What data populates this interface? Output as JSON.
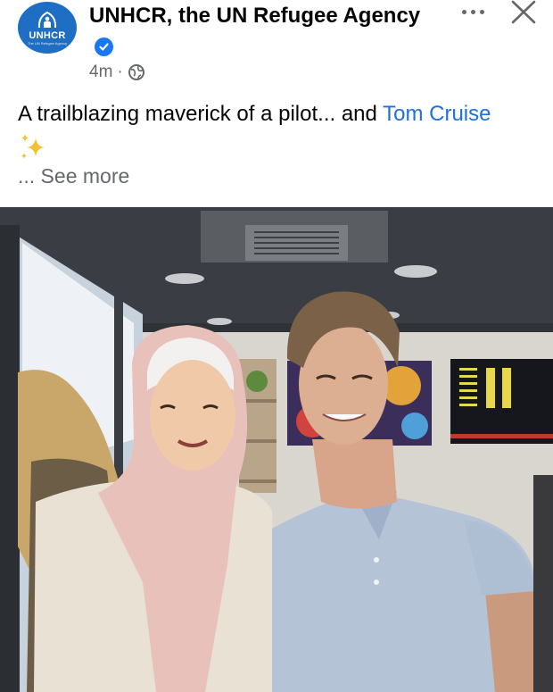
{
  "app": {
    "page_name": "UNHCR, the UN Refugee Agency",
    "avatar_brand": "UNHCR",
    "avatar_subtitle": "The UN Refugee Agency",
    "time_ago": "4m",
    "separator": "·",
    "audience_icon": "globe-icon",
    "verified_icon": "verified-badge-icon"
  },
  "post": {
    "caption_text": "A trailblazing maverick of a pilot... and ",
    "caption_link": "Tom Cruise",
    "emoji": "sparkles-icon",
    "see_more": "... See more"
  },
  "header_actions": {
    "more_icon": "more-options-icon",
    "close_icon": "close-icon"
  },
  "colors": {
    "brand_blue": "#1e6fc4",
    "verified_blue": "#1877f2",
    "link_blue": "#216fdb",
    "secondary_text": "#65676b",
    "sparkle_yellow": "#f2c230"
  }
}
